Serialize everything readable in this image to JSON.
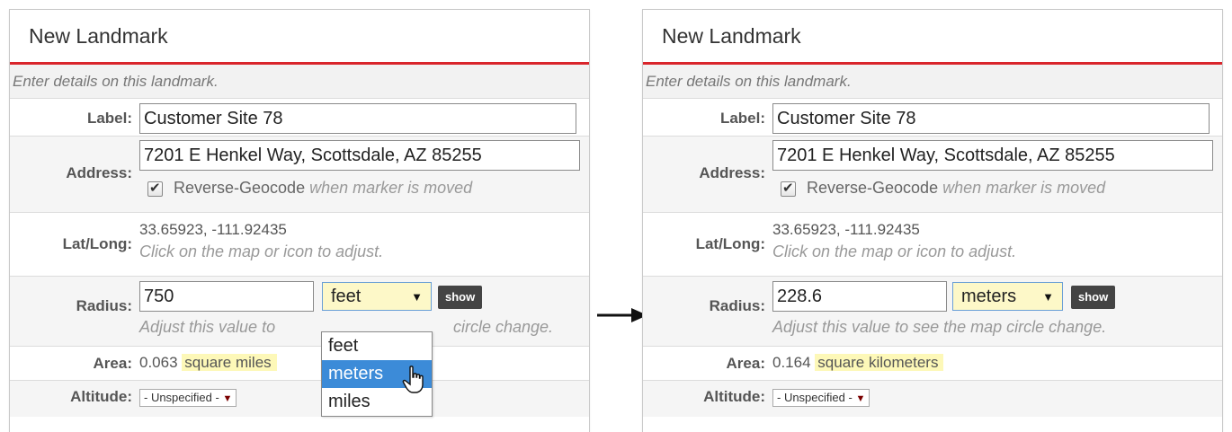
{
  "arrow": "arrow-right",
  "accent_color": "#d9252b",
  "panels": [
    {
      "title": "New Landmark",
      "intro": "Enter details on this landmark.",
      "label_caption": "Label:",
      "label_value": "Customer Site 78",
      "address_caption": "Address:",
      "address_value": "7201 E Henkel Way, Scottsdale, AZ 85255",
      "reverse_geocode": "Reverse-Geocode",
      "reverse_geocode_hint": "when marker is moved",
      "reverse_geocode_checked": true,
      "latlong_caption": "Lat/Long:",
      "latlong_value": "33.65923, -111.92435",
      "latlong_hint": "Click on the map or icon to adjust.",
      "radius_caption": "Radius:",
      "radius_value": "750",
      "radius_unit": "feet",
      "show_label": "show",
      "radius_hint_start": "Adjust this value to",
      "radius_hint_end": "circle change.",
      "area_caption": "Area:",
      "area_value": "0.063",
      "area_unit": "square miles",
      "altitude_caption": "Altitude:",
      "altitude_value": "- Unspecified -",
      "unit_options": [
        "feet",
        "meters",
        "miles"
      ],
      "unit_highlighted": "meters"
    },
    {
      "title": "New Landmark",
      "intro": "Enter details on this landmark.",
      "label_caption": "Label:",
      "label_value": "Customer Site 78",
      "address_caption": "Address:",
      "address_value": "7201 E Henkel Way, Scottsdale, AZ 85255",
      "reverse_geocode": "Reverse-Geocode",
      "reverse_geocode_hint": "when marker is moved",
      "reverse_geocode_checked": true,
      "latlong_caption": "Lat/Long:",
      "latlong_value": "33.65923, -111.92435",
      "latlong_hint": "Click on the map or icon to adjust.",
      "radius_caption": "Radius:",
      "radius_value": "228.6",
      "radius_unit": "meters",
      "show_label": "show",
      "radius_hint": "Adjust this value to see the map circle change.",
      "area_caption": "Area:",
      "area_value": "0.164",
      "area_unit": "square kilometers",
      "altitude_caption": "Altitude:",
      "altitude_value": "- Unspecified -"
    }
  ]
}
